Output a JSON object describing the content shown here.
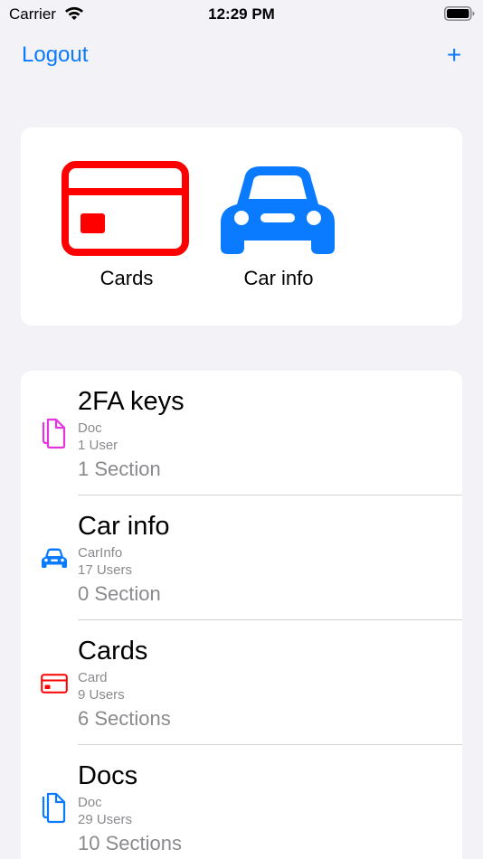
{
  "status_bar": {
    "carrier": "Carrier",
    "time": "12:29 PM"
  },
  "nav": {
    "logout_label": "Logout",
    "add_label": "+"
  },
  "favorites": [
    {
      "label": "Cards",
      "icon": "credit-card-icon",
      "color": "#FF0000"
    },
    {
      "label": "Car info",
      "icon": "car-icon",
      "color": "#0A7AFF"
    }
  ],
  "items": [
    {
      "title": "2FA keys",
      "type": "Doc",
      "users": "1 User",
      "sections": "1 Section",
      "icon": "doc-icon",
      "color": "#E535E0"
    },
    {
      "title": "Car info",
      "type": "CarInfo",
      "users": "17 Users",
      "sections": "0 Section",
      "icon": "car-icon",
      "color": "#0A7AFF"
    },
    {
      "title": "Cards",
      "type": "Card",
      "users": "9 Users",
      "sections": "6 Sections",
      "icon": "credit-card-icon",
      "color": "#FF0000"
    },
    {
      "title": "Docs",
      "type": "Doc",
      "users": "29 Users",
      "sections": "10 Sections",
      "icon": "doc-icon",
      "color": "#0A7AFF"
    }
  ]
}
